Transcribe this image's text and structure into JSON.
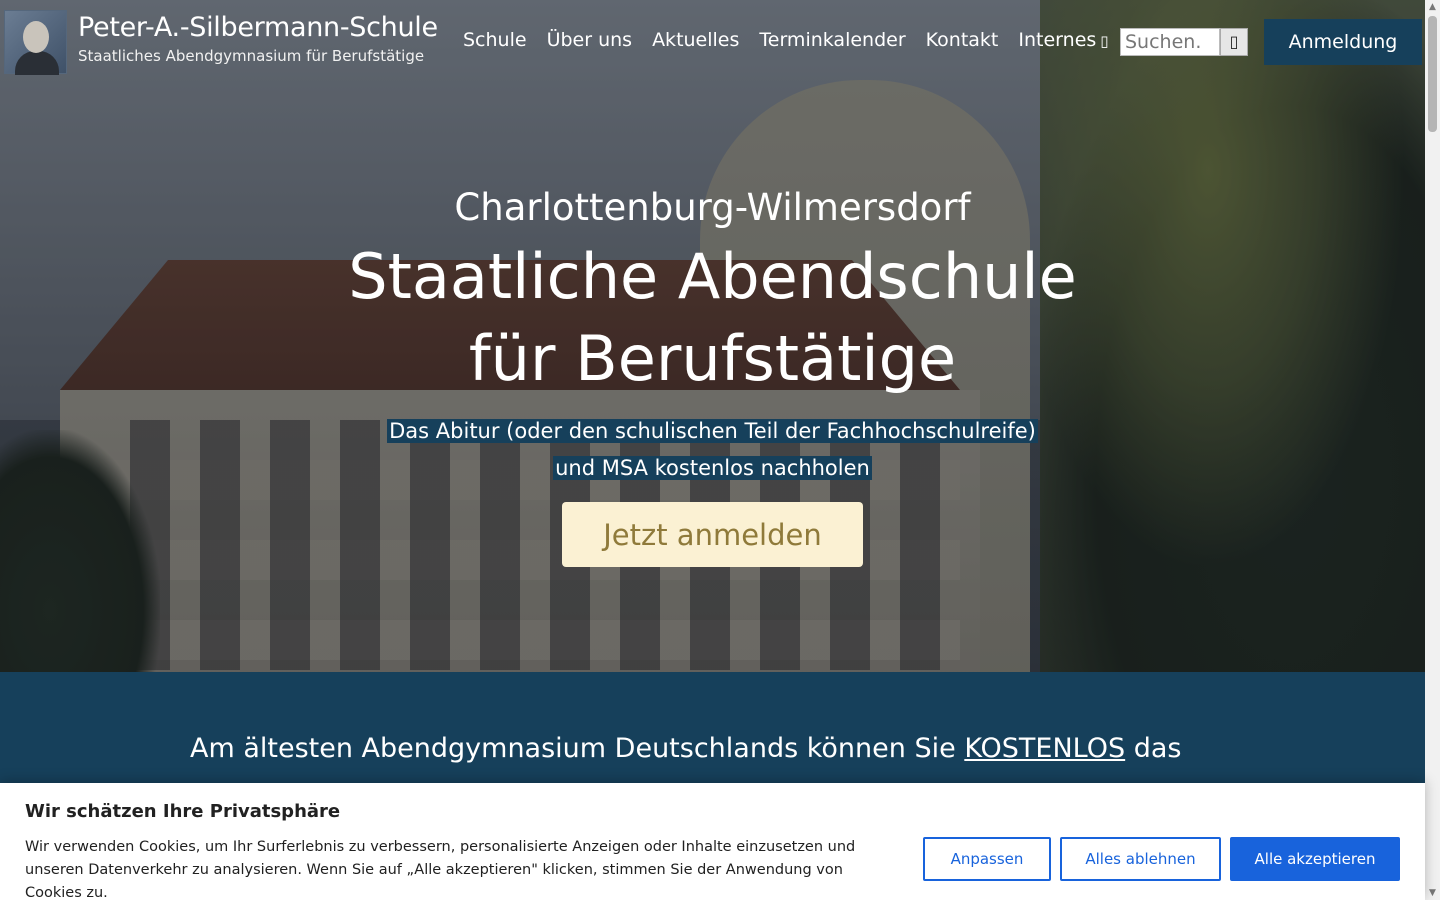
{
  "header": {
    "site_title": "Peter-A.-Silbermann-Schule",
    "site_subtitle": "Staatliches Abendgymnasium für Berufstätige",
    "nav": [
      "Schule",
      "Über uns",
      "Aktuelles",
      "Terminkalender",
      "Kontakt",
      "Internes"
    ],
    "search_placeholder": "Suchen.",
    "search_icon": "search-icon",
    "cta_label": "Anmeldung"
  },
  "hero": {
    "kicker": "Charlottenburg-Wilmersdorf",
    "title_line1": "Staatliche Abendschule",
    "title_line2": "für Berufstätige",
    "lead_line1": "Das Abitur (oder den schulischen Teil der Fachhochschulreife)",
    "lead_line2": "und MSA kostenlos nachholen",
    "cta": "Jetzt anmelden"
  },
  "intro": {
    "text_before": "Am ältesten Abendgymnasium Deutschlands können Sie ",
    "highlight": "KOSTENLOS",
    "text_after": " das"
  },
  "cookie": {
    "title": "Wir schätzen Ihre Privatsphäre",
    "text": "Wir verwenden Cookies, um Ihr Surferlebnis zu verbessern, personalisierte Anzeigen oder Inhalte einzusetzen und unseren Datenverkehr zu analysieren. Wenn Sie auf „Alle akzeptieren\" klicken, stimmen Sie der Anwendung von Cookies zu.",
    "customize": "Anpassen",
    "reject": "Alles ablehnen",
    "accept": "Alle akzeptieren"
  },
  "colors": {
    "primary": "#16405b",
    "cookie_accent": "#1863dc",
    "cta_bg": "#fbf1d3",
    "cta_text": "#8f7a3a"
  }
}
